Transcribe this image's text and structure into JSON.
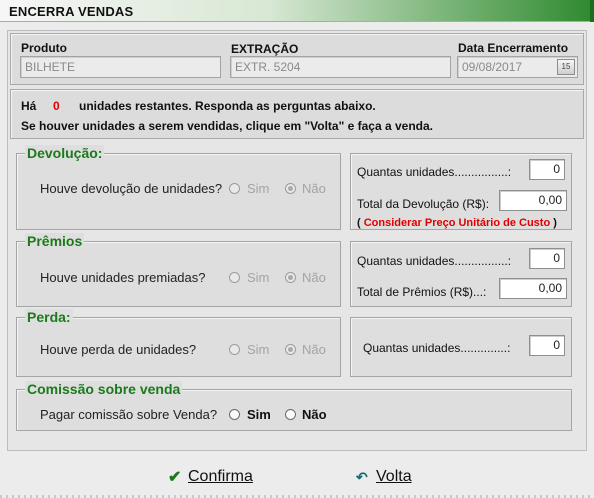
{
  "window": {
    "title": "ENCERRA VENDAS"
  },
  "header": {
    "produto_label": "Produto",
    "produto_value": "BILHETE",
    "extracao_label": "EXTRAÇÃO",
    "extracao_value": "EXTR. 5204",
    "data_label": "Data Encerramento",
    "data_value": "09/08/2017",
    "calendar_icon": "calendar-icon",
    "calendar_text": "15"
  },
  "info": {
    "prefix": "Há",
    "count": "0",
    "line1_rest": "unidades restantes. Responda as perguntas abaixo.",
    "line2": "Se houver unidades a serem vendidas, clique em \"Volta\" e faça a venda."
  },
  "devolucao": {
    "title": "Devolução:",
    "question": "Houve devolução de unidades?",
    "opt_sim": "Sim",
    "opt_nao": "Não",
    "selected": "Não",
    "qty_label": "Quantas unidades................:",
    "qty_value": "0",
    "total_label": "Total da Devolução (R$):",
    "total_value": "0,00",
    "hint_open": "(",
    "hint_text": "Considerar Preço Unitário de Custo",
    "hint_close": ")"
  },
  "premios": {
    "title": "Prêmios",
    "question": "Houve unidades premiadas?",
    "opt_sim": "Sim",
    "opt_nao": "Não",
    "selected": "Não",
    "qty_label": "Quantas unidades................:",
    "qty_value": "0",
    "total_label": "Total de Prêmios (R$)...:",
    "total_value": "0,00"
  },
  "perda": {
    "title": "Perda:",
    "question": "Houve perda de unidades?",
    "opt_sim": "Sim",
    "opt_nao": "Não",
    "selected": "Não",
    "qty_label": "Quantas unidades..............:",
    "qty_value": "0"
  },
  "comissao": {
    "title": "Comissão sobre venda",
    "question": "Pagar comissão sobre Venda?",
    "opt_sim": "Sim",
    "opt_nao": "Não",
    "selected": null
  },
  "actions": {
    "confirm_icon": "check-icon",
    "confirm_label": "Confirma",
    "back_icon": "undo-arrow-icon",
    "back_label": "Volta"
  },
  "colors": {
    "accent_green": "#1b7a1b",
    "title_gradient_end": "#2e8a2e",
    "alert_red": "#e00000"
  }
}
